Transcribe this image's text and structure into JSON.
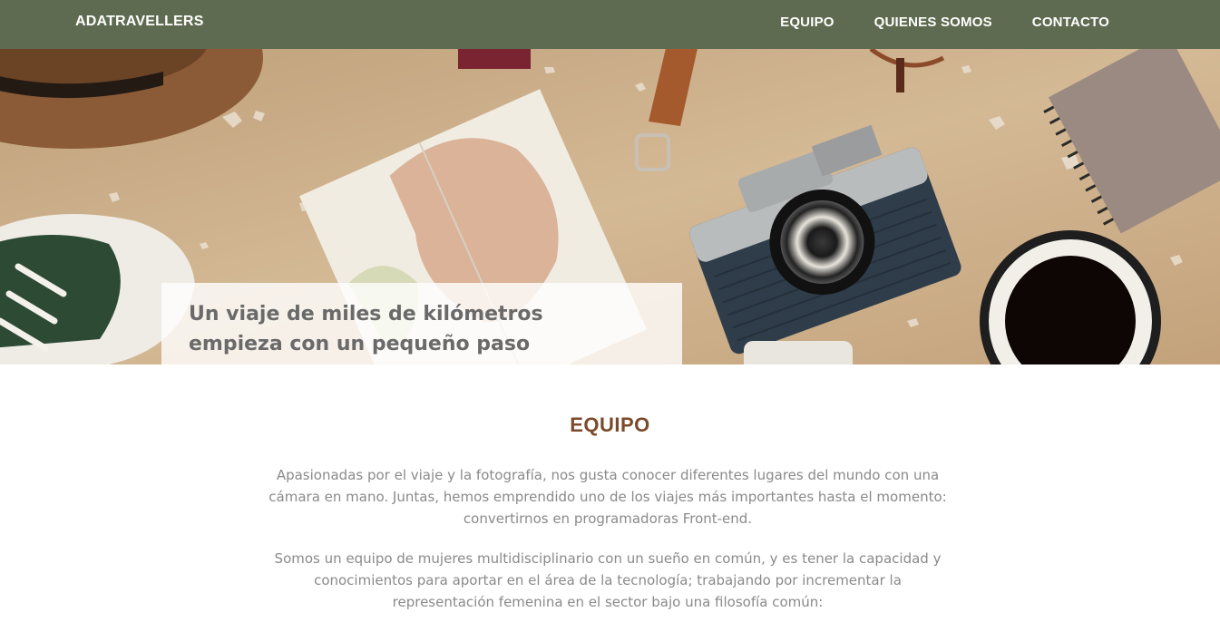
{
  "navbar": {
    "brand": "ADATRAVELLERS",
    "links": [
      "EQUIPO",
      "QUIENES SOMOS",
      "CONTACTO"
    ],
    "background": "#5f6b50"
  },
  "hero": {
    "quote": "Un viaje de miles de kilómetros empieza con un pequeño paso"
  },
  "team": {
    "title": "EQUIPO",
    "title_color": "#7b4a2c",
    "paragraphs": [
      "Apasionadas por el viaje y la fotografía, nos gusta conocer diferentes lugares del mundo con una cámara en mano. Juntas, hemos emprendido uno de los viajes más importantes hasta el momento: convertirnos en programadoras Front-end.",
      "Somos un equipo de mujeres multidisciplinario con un sueño en común, y es tener la capacidad y conocimientos para aportar en el área de la tecnología; trabajando por incrementar la representación femenina en el sector bajo una filosofía común:"
    ]
  }
}
